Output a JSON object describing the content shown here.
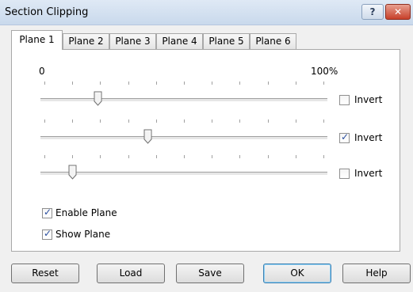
{
  "window": {
    "title": "Section Clipping"
  },
  "title_buttons": {
    "help_icon": "question-icon",
    "help_label": "?",
    "close_icon": "close-icon",
    "close_label": "✕"
  },
  "tabs": [
    {
      "label": "Plane 1",
      "active": true
    },
    {
      "label": "Plane 2",
      "active": false
    },
    {
      "label": "Plane 3",
      "active": false
    },
    {
      "label": "Plane 4",
      "active": false
    },
    {
      "label": "Plane 5",
      "active": false
    },
    {
      "label": "Plane 6",
      "active": false
    }
  ],
  "scale": {
    "min_label": "0",
    "max_label": "100%"
  },
  "sliders": [
    {
      "value": 0.19,
      "invert_label": "Invert",
      "invert_checked": false
    },
    {
      "value": 0.37,
      "invert_label": "Invert",
      "invert_checked": true
    },
    {
      "value": 0.1,
      "invert_label": "Invert",
      "invert_checked": false
    }
  ],
  "options": {
    "enable_plane": {
      "label": "Enable Plane",
      "checked": true
    },
    "show_plane": {
      "label": "Show Plane",
      "checked": true
    }
  },
  "buttons": {
    "reset": "Reset",
    "load": "Load",
    "save": "Save",
    "ok": "OK",
    "help": "Help"
  },
  "colors": {
    "check": "#2a4fa0",
    "close": "#c7402a",
    "default_button_border": "#3c7fb1"
  }
}
